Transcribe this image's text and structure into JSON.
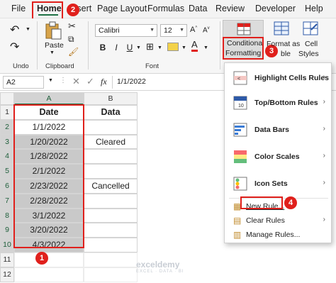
{
  "menubar": {
    "tabs": [
      {
        "label": "File"
      },
      {
        "label": "Home"
      },
      {
        "label": "Insert"
      },
      {
        "label": "Page Layout"
      },
      {
        "label": "Formulas"
      },
      {
        "label": "Data"
      },
      {
        "label": "Review"
      },
      {
        "label": "Developer"
      },
      {
        "label": "Help"
      }
    ]
  },
  "ribbon": {
    "undo_label": "Undo",
    "paste_label": "Paste",
    "clipboard_label": "Clipboard",
    "font_label": "Font",
    "font_name": "Calibri",
    "font_size": "12",
    "bold": "B",
    "italic": "I",
    "underline": "U",
    "cf_label_line1": "Conditional",
    "cf_label_line2": "Formatting",
    "format_as_line1": "Format as",
    "format_as_line2": "ble",
    "cell_styles_line1": "Cell",
    "cell_styles_line2": "Styles"
  },
  "formula_bar": {
    "name_box": "A2",
    "fx": "fx",
    "value": "1/1/2022"
  },
  "sheet": {
    "columns": [
      "A",
      "B"
    ],
    "rows": [
      "1",
      "2",
      "3",
      "4",
      "5",
      "6",
      "7",
      "8",
      "9",
      "10",
      "11",
      "12"
    ],
    "header_a": "Date",
    "header_b": "Data",
    "col_a": [
      "1/1/2022",
      "1/20/2022",
      "1/28/2022",
      "2/1/2022",
      "2/23/2022",
      "2/28/2022",
      "3/1/2022",
      "3/20/2022",
      "4/3/2022"
    ],
    "col_b": [
      "",
      "Cleared",
      "",
      "",
      "Cancelled",
      "",
      "",
      "",
      ""
    ]
  },
  "cf_menu": {
    "items": [
      {
        "label": "Highlight Cells Rules",
        "icon": "highlight-cells-icon"
      },
      {
        "label": "Top/Bottom Rules",
        "icon": "top-bottom-icon"
      },
      {
        "label": "Data Bars",
        "icon": "data-bars-icon"
      },
      {
        "label": "Color Scales",
        "icon": "color-scales-icon"
      },
      {
        "label": "Icon Sets",
        "icon": "icon-sets-icon"
      },
      {
        "label": "New Rule...",
        "icon": "new-rule-icon"
      },
      {
        "label": "Clear Rules",
        "icon": "clear-rules-icon"
      },
      {
        "label": "Manage Rules...",
        "icon": "manage-rules-icon"
      }
    ]
  },
  "badges": [
    "1",
    "2",
    "3",
    "4"
  ],
  "watermark": {
    "name": "exceldemy",
    "tagline": "EXCEL · DATA · BI"
  },
  "colors": {
    "accent": "#1e7145",
    "highlight": "#e0201c",
    "shade": "#c9c9c9"
  }
}
